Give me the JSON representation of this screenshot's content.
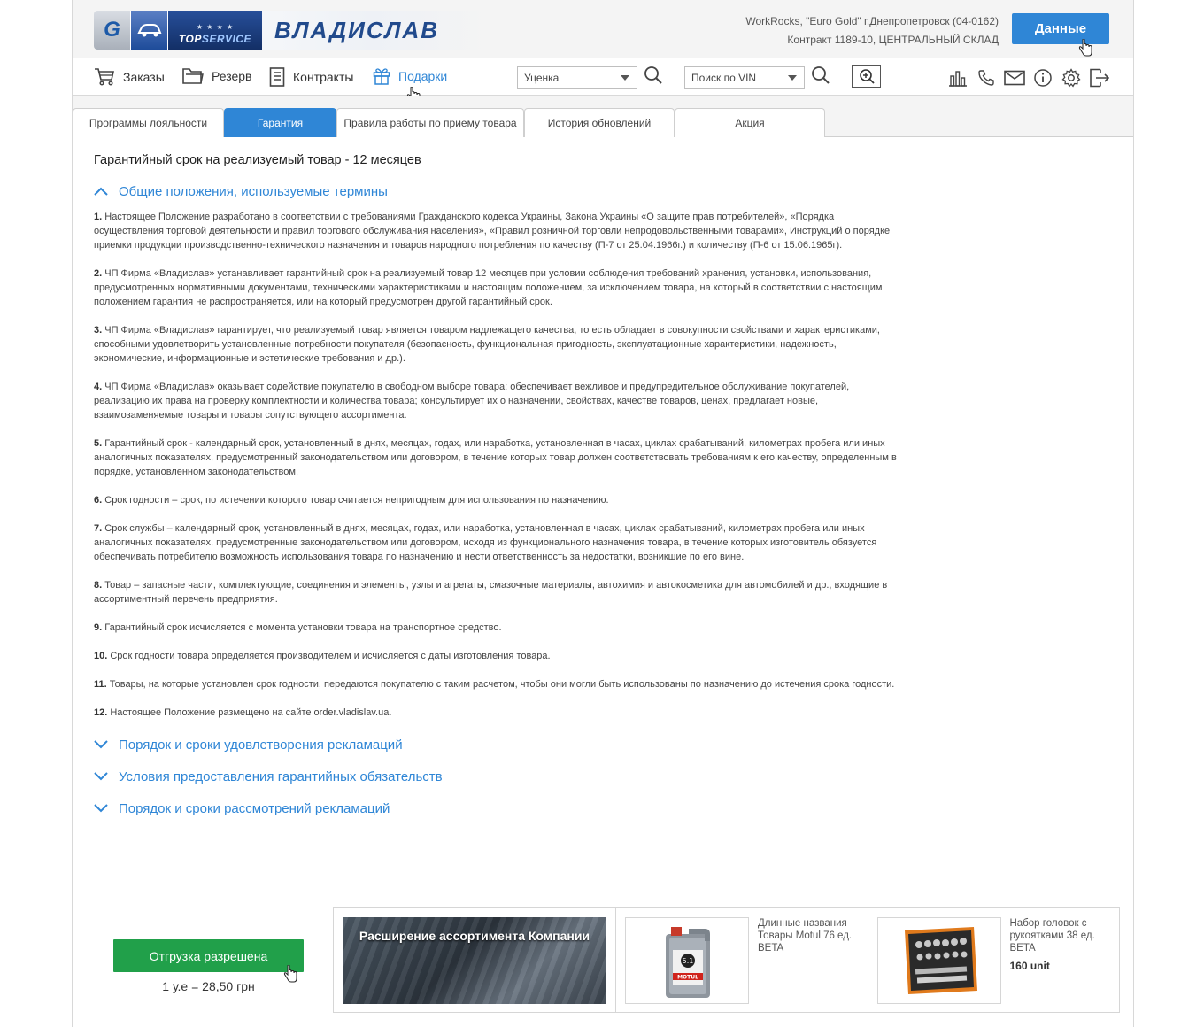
{
  "header": {
    "brand_name": "ВЛАДИСЛАВ",
    "logo_top_text_1": "TOP",
    "logo_top_text_2": "SERVICE",
    "logo_g": "G",
    "company_line1": "WorkRocks, \"Euro Gold\" г.Днепропетровск (04-0162)",
    "company_line2": "Контракт 1189-10, ЦЕНТРАЛЬНЫЙ СКЛАД",
    "data_button": "Данные"
  },
  "nav": {
    "items": [
      {
        "label": "Заказы",
        "icon": "cart-icon"
      },
      {
        "label": "Резерв",
        "icon": "folder-icon"
      },
      {
        "label": "Контракты",
        "icon": "document-icon"
      },
      {
        "label": "Подарки",
        "icon": "gift-icon"
      }
    ],
    "select1": "Уценка",
    "select2": "Поиск по VIN",
    "tools": [
      "stats-icon",
      "phone-icon",
      "mail-icon",
      "info-icon",
      "settings-icon",
      "logout-icon"
    ]
  },
  "tabs": [
    {
      "label": "Программы лояльности",
      "active": false
    },
    {
      "label": "Гарантия",
      "active": true
    },
    {
      "label": "Правила работы по приему товара",
      "active": false
    },
    {
      "label": "История обновлений",
      "active": false
    },
    {
      "label": "Акция",
      "active": false
    }
  ],
  "content": {
    "title": "Гарантийный срок на реализуемый товар - 12 месяцев",
    "section_open": "Общие положения, используемые термины",
    "paragraphs": [
      {
        "num": "1.",
        "text": " Настоящее Положение разработано в соответствии с требованиями Гражданского кодекса Украины, Закона Украины «О защите прав потребителей», «Порядка осуществления торговой деятельности и правил торгового обслуживания населения», «Правил розничной торговли непродовольственными товарами», Инструкций о порядке приемки продукции производственно-технического назначения и товаров народного потребления по качеству (П-7 от 25.04.1966г.) и количеству (П-6 от 15.06.1965г)."
      },
      {
        "num": "2.",
        "text": " ЧП Фирма «Владислав» устанавливает гарантийный срок на реализуемый товар 12 месяцев при условии соблюдения требований хранения, установки, использования, предусмотренных нормативными документами, техническими характеристиками и настоящим положением, за исключением товара, на который в соответствии с настоящим положением гарантия не распространяется, или на который предусмотрен другой гарантийный срок."
      },
      {
        "num": "3.",
        "text": " ЧП Фирма «Владислав» гарантирует, что реализуемый товар является товаром надлежащего качества, то есть обладает в совокупности свойствами и характеристиками, способными удовлетворить установленные потребности покупателя (безопасность, функциональная пригодность, эксплуатационные характеристики, надежность, экономические, информационные и эстетические требования и др.)."
      },
      {
        "num": "4.",
        "text": " ЧП Фирма «Владислав» оказывает содействие покупателю в свободном выборе товара; обеспечивает вежливое и предупредительное обслуживание покупателей, реализацию их права на проверку комплектности и количества товара; консультирует их о назначении, свойствах, качестве товаров, ценах, предлагает новые, взаимозаменяемые товары и товары сопутствующего ассортимента."
      },
      {
        "num": "5.",
        "text": " Гарантийный срок - календарный срок, установленный в днях, месяцах, годах, или наработка, установленная в часах, циклах срабатываний, километрах пробега или иных аналогичных показателях, предусмотренный законодательством или договором, в течение которых товар должен соответствовать требованиям к его качеству, определенным в порядке, установленном законодательством."
      },
      {
        "num": "6.",
        "text": " Срок годности – срок, по истечении которого товар считается непригодным для использования по назначению."
      },
      {
        "num": "7.",
        "text": " Срок службы – календарный срок, установленный в днях, месяцах, годах, или наработка, установленная в часах, циклах срабатываний, километрах пробега или иных аналогичных показателях, предусмотренные законодательством или договором, исходя из функционального назначения товара, в течение которых изготовитель обязуется обеспечивать потребителю возможность использования товара по назначению и нести ответственность за недостатки, возникшие по его вине."
      },
      {
        "num": "8.",
        "text": " Товар – запасные части, комплектующие, соединения и элементы, узлы и агрегаты, смазочные материалы, автохимия и автокосметика для автомобилей и др., входящие в ассортиментный перечень предприятия."
      },
      {
        "num": "9.",
        "text": " Гарантийный срок исчисляется с момента установки товара на транспортное средство."
      },
      {
        "num": "10.",
        "text": " Срок годности товара определяется производителем и исчисляется с даты изготовления товара."
      },
      {
        "num": "11.",
        "text": " Товары, на которые установлен срок годности, передаются покупателю с таким расчетом, чтобы они могли быть использованы по назначению до истечения срока годности."
      },
      {
        "num": "12.",
        "text": " Настоящее Положение размещено на сайте order.vladislav.ua."
      }
    ],
    "sections_collapsed": [
      "Порядок и сроки удовлетворения рекламаций",
      "Условия предоставления гарантийных обязательств",
      "Порядок и сроки рассмотрений рекламаций"
    ]
  },
  "footer": {
    "ship_button": "Отгрузка разрешена",
    "rate": "1 у.е = 28,50 грн",
    "banner_text": "Расширение ассортимента Компании",
    "product1": {
      "name": "Длинные названия Товары Motul 76 ед. BETA",
      "unit": ""
    },
    "product2": {
      "name": "Набор головок с рукоятками 38 ед. BETA",
      "unit": "160 unit"
    }
  },
  "colors": {
    "accent": "#2f86d6",
    "success": "#21a04a"
  }
}
